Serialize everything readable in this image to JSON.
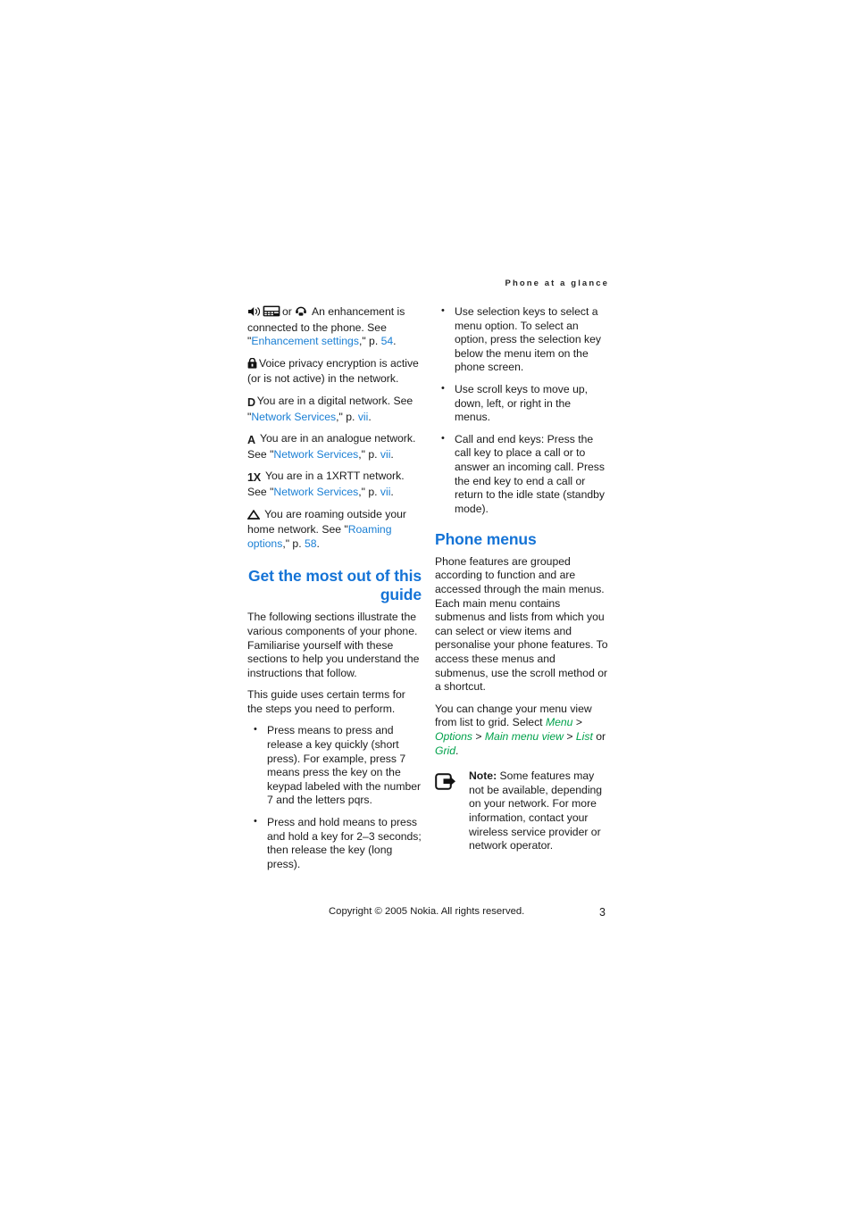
{
  "header": {
    "running_head": "Phone at a glance"
  },
  "left_column": {
    "indicators": [
      {
        "icons": [
          "speaker-icon",
          "car-kit-icon",
          "headset-icon"
        ],
        "separator": "or",
        "text_before": "An enhancement is connected to the phone. See \"",
        "link": "Enhancement settings",
        "text_after": ",\" p. ",
        "page_link": "54",
        "end": "."
      },
      {
        "icons": [
          "padlock-icon"
        ],
        "text": "Voice privacy encryption is active (or is not active) in the network."
      },
      {
        "icons": [
          "digital-network-icon"
        ],
        "glyph": "D",
        "text_before": "You are in a digital network. See \"",
        "link": "Network Services",
        "text_after": ",\" p. ",
        "page_link": "vii",
        "end": "."
      },
      {
        "icons": [
          "analogue-network-icon"
        ],
        "glyph": "A",
        "text_before": "You are in an analogue network. See \"",
        "link": "Network Services",
        "text_after": ",\" p. ",
        "page_link": "vii",
        "end": "."
      },
      {
        "icons": [
          "1xrtt-network-icon"
        ],
        "glyph": "1X",
        "text_before": "You are in a 1XRTT network. See \"",
        "link": "Network Services",
        "text_after": ",\" p. ",
        "page_link": "vii",
        "end": "."
      },
      {
        "icons": [
          "roaming-triangle-icon"
        ],
        "text_before": "You are roaming outside your home network. See \"",
        "link": "Roaming options",
        "text_after": ",\" p. ",
        "page_link": "58",
        "end": "."
      }
    ],
    "heading": "Get the most out of this guide",
    "para1": "The following sections illustrate the various components of your phone. Familiarise yourself with these sections to help you understand the instructions that follow.",
    "para2": "This guide uses certain terms for the steps you need to perform.",
    "bullets": [
      "Press means to press and release a key quickly (short press). For example, press 7 means press the key on the keypad labeled with the number 7 and the letters pqrs.",
      "Press and hold means to press and hold a key for 2–3 seconds; then release the key (long press)."
    ]
  },
  "right_column": {
    "bullets": [
      "Use selection keys to select a menu option. To select an option, press the selection key below the menu item on the phone screen.",
      "Use scroll keys to move up, down, left, or right in the menus.",
      "Call and end keys: Press the call key to place a call or to answer an incoming call. Press the end key to end a call or return to the idle state (standby mode)."
    ],
    "heading": "Phone menus",
    "para1": "Phone features are grouped according to function and are accessed through the main menus. Each main menu contains submenus and lists from which you can select or view items and personalise your phone features. To access these menus and submenus, use the scroll method or a shortcut.",
    "para2_before": "You can change your menu view from list to grid. Select ",
    "menu_path": {
      "item1": "Menu",
      "sep1": " > ",
      "item2": "Options",
      "sep2": " > ",
      "item3": "Main menu view",
      "sep3": " > ",
      "item4": "List",
      "sep4": " or ",
      "item5": "Grid",
      "end": "."
    },
    "note": {
      "icon": "note-arrow-icon",
      "label": "Note:",
      "text": " Some features may not be available, depending on your network. For more information, contact your wireless service provider or network operator."
    }
  },
  "footer": {
    "copyright": "Copyright © 2005 Nokia. All rights reserved.",
    "page_number": "3"
  },
  "colors": {
    "heading_blue": "#1473d6",
    "link_blue": "#1a7fd4",
    "menu_green": "#00a14b",
    "text": "#1a1a1a"
  }
}
